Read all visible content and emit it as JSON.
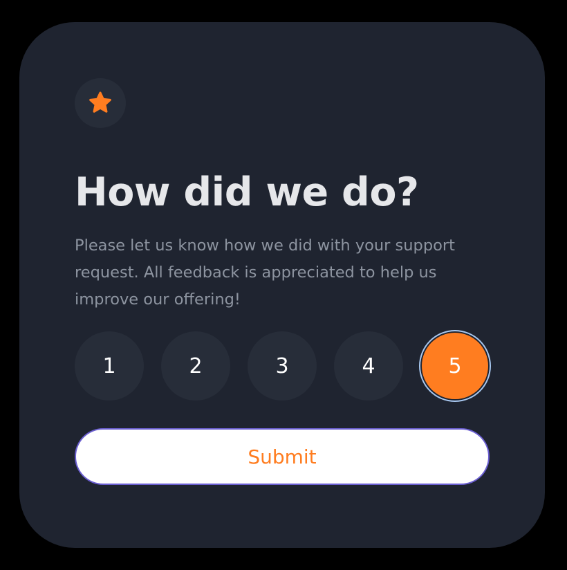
{
  "header": {
    "icon": "star-icon",
    "icon_color": "#ff7d20"
  },
  "main": {
    "title": "How did we do?",
    "description": "Please let us know how we did with your support request. All feedback is appreciated to help us improve our offering!"
  },
  "rating": {
    "options": [
      "1",
      "2",
      "3",
      "4",
      "5"
    ],
    "selected": "5",
    "accent_color": "#ff7d20"
  },
  "actions": {
    "submit_label": "Submit"
  }
}
